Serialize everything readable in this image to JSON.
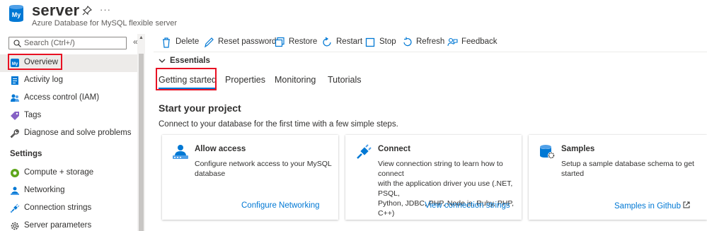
{
  "header": {
    "title": "server",
    "subtitle": "Azure Database for MySQL flexible server",
    "icon_text": "My",
    "more": "···"
  },
  "sidebar": {
    "search_placeholder": "Search (Ctrl+/)",
    "collapse": "«",
    "items": [
      {
        "label": "Overview",
        "icon": "mysql-server-icon"
      },
      {
        "label": "Activity log",
        "icon": "activity-log-icon"
      },
      {
        "label": "Access control (IAM)",
        "icon": "iam-icon"
      },
      {
        "label": "Tags",
        "icon": "tag-icon"
      },
      {
        "label": "Diagnose and solve problems",
        "icon": "wrench-icon"
      }
    ],
    "section_label": "Settings",
    "settings_items": [
      {
        "label": "Compute + storage",
        "icon": "compute-icon"
      },
      {
        "label": "Networking",
        "icon": "networking-icon"
      },
      {
        "label": "Connection strings",
        "icon": "plug-icon"
      },
      {
        "label": "Server parameters",
        "icon": "gear-icon"
      }
    ]
  },
  "toolbar": {
    "delete": "Delete",
    "reset_password": "Reset password",
    "restore": "Restore",
    "restart": "Restart",
    "stop": "Stop",
    "refresh": "Refresh",
    "feedback": "Feedback"
  },
  "essentials": {
    "label": "Essentials"
  },
  "tabs": [
    "Getting started",
    "Properties",
    "Monitoring",
    "Tutorials"
  ],
  "main": {
    "title": "Start your project",
    "subtitle": "Connect to your database for the first time with a few simple steps."
  },
  "cards": [
    {
      "title": "Allow access",
      "desc1": "Configure network access to your MySQL",
      "desc2": "database",
      "desc3": "",
      "link": "Configure Networking"
    },
    {
      "title": "Connect",
      "desc1": "View connection string to learn how to connect",
      "desc2": "with the application driver you use (.NET, PSQL,",
      "desc3": "Python, JDBC, PHP, Node.js, Ruby, PHP, C++)",
      "link": "View connection strings"
    },
    {
      "title": "Samples",
      "desc1": "Setup a sample database schema to get started",
      "desc2": "",
      "desc3": "",
      "link": "Samples in Github"
    }
  ],
  "colors": {
    "accent": "#0078d4",
    "highlight": "#e81123",
    "text": "#323130"
  }
}
